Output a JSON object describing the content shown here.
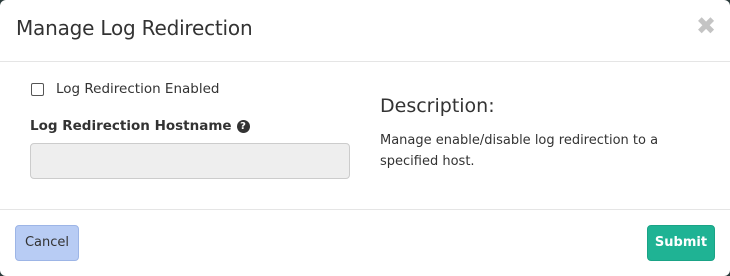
{
  "modal": {
    "title": "Manage Log Redirection",
    "close_icon": "close-icon"
  },
  "form": {
    "checkbox_label": "Log Redirection Enabled",
    "checkbox_checked": false,
    "hostname_label": "Log Redirection Hostname",
    "hostname_help_icon": "question-circle-icon",
    "hostname_value": "",
    "hostname_placeholder": ""
  },
  "description": {
    "title": "Description:",
    "text": "Manage enable/disable log redirection to a specified host."
  },
  "footer": {
    "cancel_label": "Cancel",
    "submit_label": "Submit"
  },
  "colors": {
    "submit_button": "#1fb394",
    "cancel_button": "#b8ccf4",
    "input_background": "#eeeeee"
  }
}
